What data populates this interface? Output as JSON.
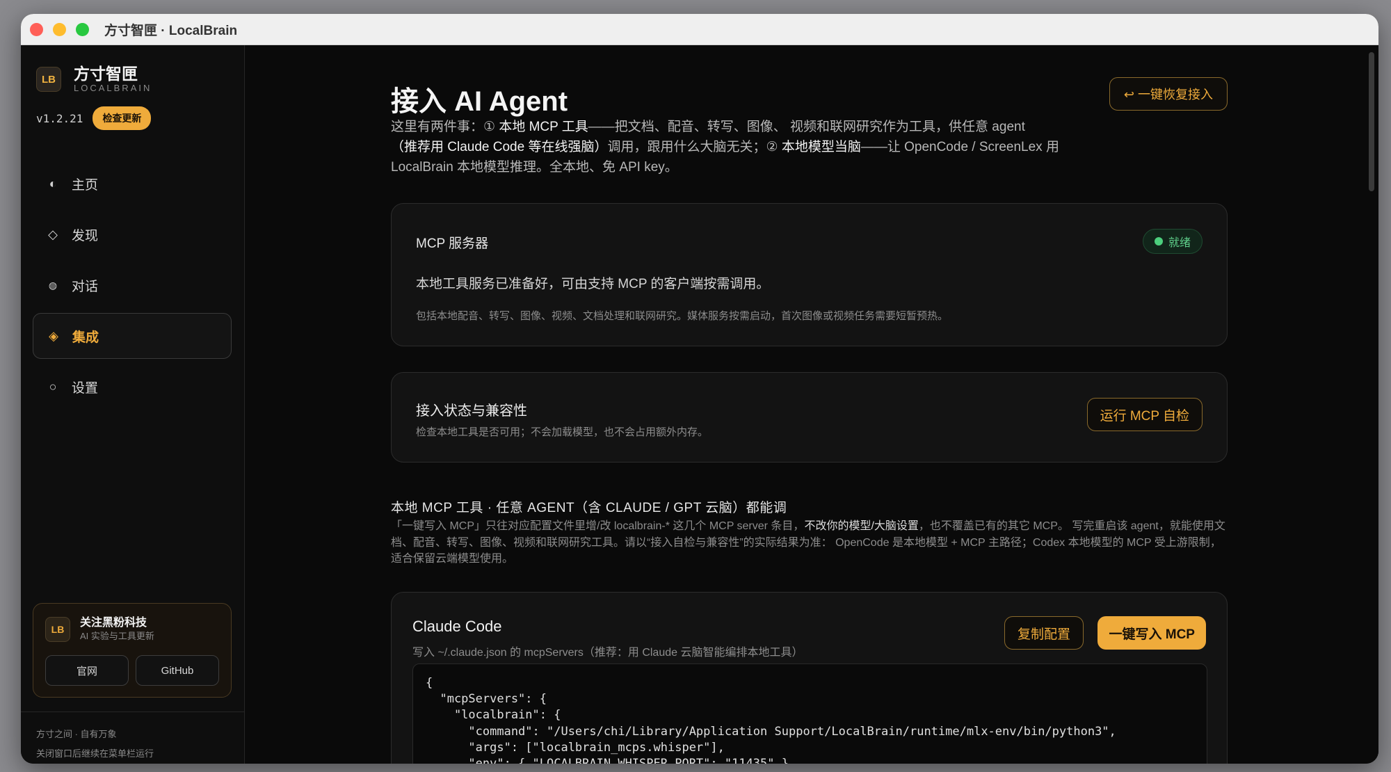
{
  "window": {
    "title": "方寸智匣 · LocalBrain",
    "colors": {
      "close": "#ff5f57",
      "minimize": "#febc2e",
      "zoom": "#28c840",
      "accent": "#efab3b",
      "ready": "#4ccf7d"
    }
  },
  "sidebar": {
    "logo": "LB",
    "brand_name": "方寸智匣",
    "brand_sub": "LOCALBRAIN",
    "version": "v1.2.21",
    "update_label": "检查更新",
    "items": [
      {
        "label": "主页",
        "icon": "half-circle-icon",
        "glyph": "◐"
      },
      {
        "label": "发现",
        "icon": "diamond-outline-icon",
        "glyph": "◇"
      },
      {
        "label": "对话",
        "icon": "dot-icon",
        "glyph": "◍"
      },
      {
        "label": "集成",
        "icon": "diamond-filled-icon",
        "glyph": "◈"
      },
      {
        "label": "设置",
        "icon": "circle-outline-icon",
        "glyph": "○"
      }
    ],
    "promo": {
      "logo": "LB",
      "title": "关注黑粉科技",
      "subtitle": "AI 实验与工具更新",
      "btn_site": "官网",
      "btn_github": "GitHub"
    },
    "footer_line1": "方寸之间 · 自有万象",
    "footer_line2": "关闭窗口后继续在菜单栏运行"
  },
  "main": {
    "title": "接入 AI Agent",
    "restore_label": "↩ 一键恢复接入",
    "intro": {
      "p1": "这里有两件事：① ",
      "s1": "本地 MCP 工具",
      "p2": "——把文档、配音、转写、图像、 视频和联网研究作为工具，供任意 agent",
      "s2": "（推荐用 Claude Code 等在线强脑）",
      "p3": "调用，跟用什么大脑无关；② ",
      "s3": "本地模型当脑",
      "p4": "——让 OpenCode / ScreenLex 用 LocalBrain 本地模型推理。全本地、免 API key。"
    },
    "mcp_card": {
      "title": "MCP 服务器",
      "badge": "就绪",
      "line1": "本地工具服务已准备好，可由支持 MCP 的客户端按需调用。",
      "line2": "包括本地配音、转写、图像、视频、文档处理和联网研究。媒体服务按需启动，首次图像或视频任务需要短暂预热。"
    },
    "status_card": {
      "title": "接入状态与兼容性",
      "subtitle": "检查本地工具是否可用；不会加载模型，也不会占用额外内存。",
      "button": "运行 MCP 自检"
    },
    "tools_section": {
      "heading": "本地 MCP 工具 · 任意 AGENT（含 CLAUDE / GPT 云脑）都能调",
      "d1": "「一键写入 MCP」只往对应配置文件里增/改 localbrain-* 这几个 MCP server 条目，",
      "d2": "不改你的模型/大脑设置",
      "d3": "，也不覆盖已有的其它 MCP。 写完重启该 agent，就能使用文档、配音、转写、图像、视频和联网研究工具。请以“接入自检与兼容性”的实际结果为准： OpenCode 是本地模型 + MCP 主路径；Codex 本地模型的 MCP 受上游限制，适合保留云端模型使用。"
    },
    "claude_card": {
      "title": "Claude Code",
      "subtitle": "写入 ~/.claude.json 的 mcpServers（推荐：用 Claude 云脑智能编排本地工具）",
      "copy_label": "复制配置",
      "write_label": "一键写入 MCP",
      "code": "{\n  \"mcpServers\": {\n    \"localbrain\": {\n      \"command\": \"/Users/chi/Library/Application Support/LocalBrain/runtime/mlx-env/bin/python3\",\n      \"args\": [\"localbrain_mcps.whisper\"],\n      \"env\": { \"LOCALBRAIN_WHISPER_PORT\": \"11435\" }"
    }
  }
}
